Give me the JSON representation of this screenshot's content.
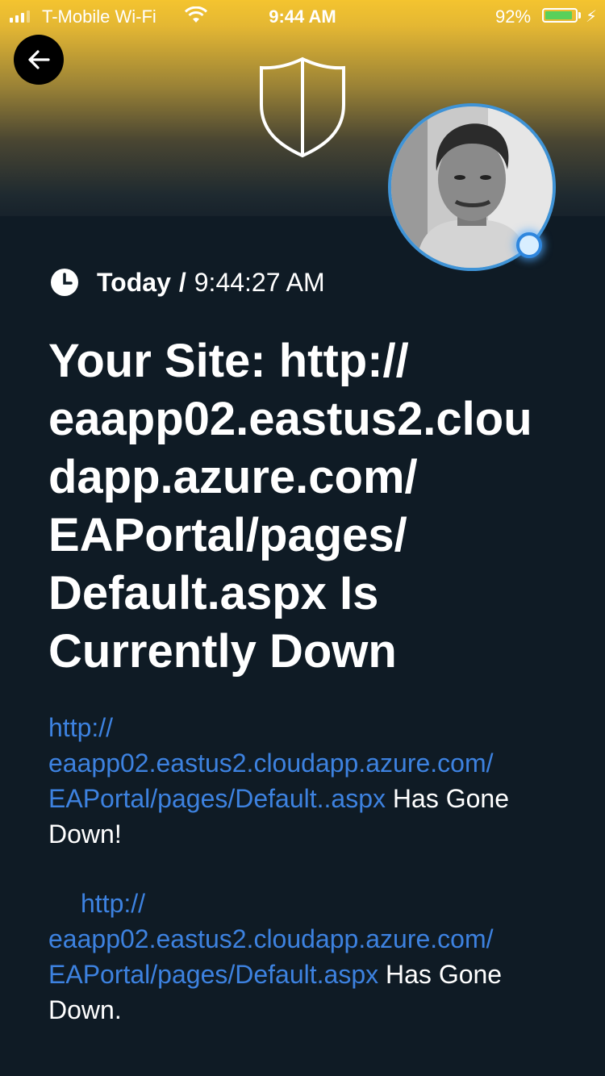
{
  "status_bar": {
    "carrier": "T-Mobile Wi-Fi",
    "time": "9:44 AM",
    "battery_percent": "92%",
    "battery_level": 0.92,
    "signal_bars": 3
  },
  "header": {
    "back_icon": "arrow-left-icon",
    "logo_icon": "shield-icon"
  },
  "alert": {
    "day": "Today",
    "separator": "/",
    "time": "9:44:27 AM",
    "title_lines": [
      "Your Site: http://",
      "eaapp02.eastus2.clou",
      "dapp.azure.com/",
      "EAPortal/pages/",
      "Default.aspx Is",
      "Currently Down"
    ],
    "messages": [
      {
        "link_lines": [
          "http://",
          "eaapp02.eastus2.cloudapp.azure.com/",
          "EAPortal/pages/Default..aspx"
        ],
        "text_a": "Has Gone",
        "text_b": "Down!"
      },
      {
        "link_lines": [
          "http://",
          "eaapp02.eastus2.cloudapp.azure.com/",
          "EAPortal/pages/Default.aspx"
        ],
        "text_a": "Has Gone",
        "text_b": "Down."
      }
    ]
  },
  "colors": {
    "background": "#0f1b25",
    "header_gold": "#f4c42f",
    "link": "#3d82e0",
    "avatar_ring": "#3f93d6",
    "battery": "#5ad05a"
  }
}
